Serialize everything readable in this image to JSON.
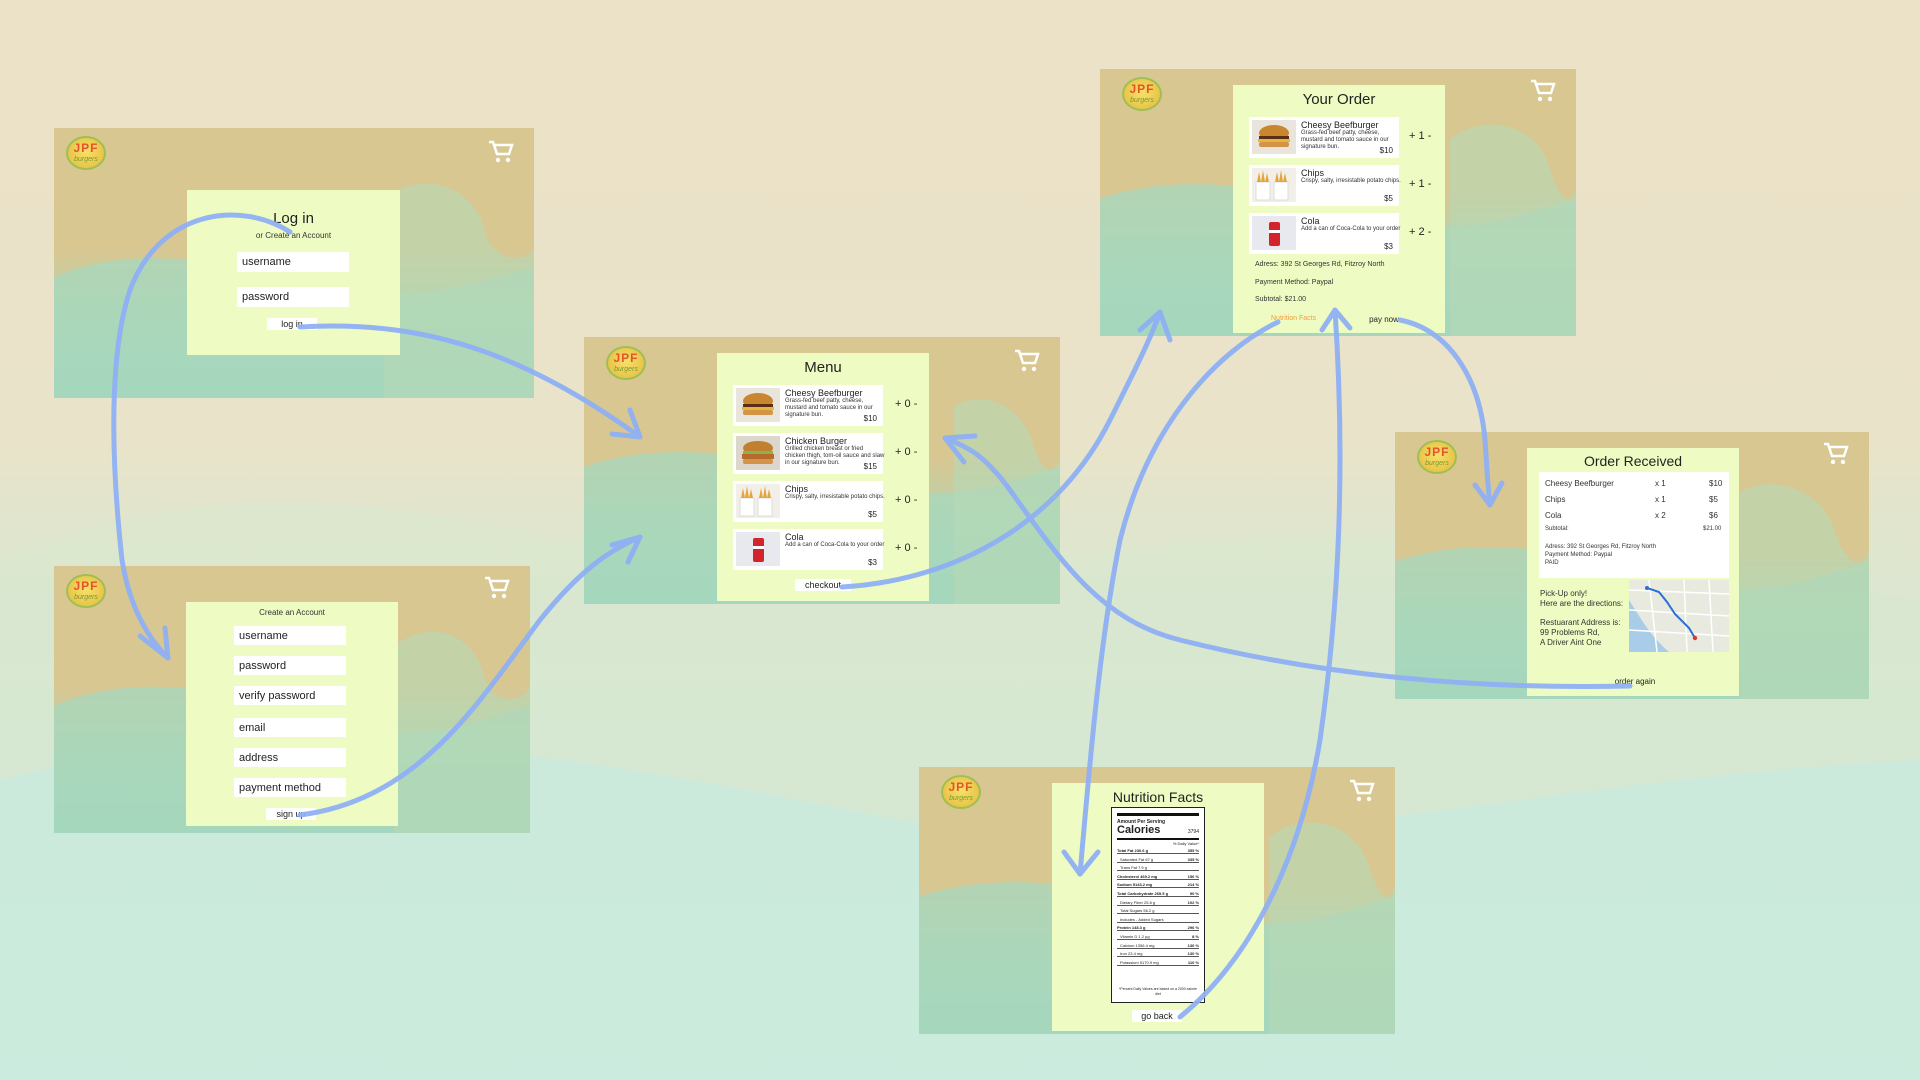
{
  "brand": {
    "logo_line1": "JPF",
    "logo_line2": "burgers"
  },
  "colors": {
    "card_bg": "#eefcc3",
    "accent_orange": "#f39c3c",
    "arrow": "#8fb0f4",
    "header_tan": "#d8c790",
    "footer_teal": "#92d6c5"
  },
  "icons": {
    "cart": "cart-icon",
    "logo": "logo-icon"
  },
  "login": {
    "title": "Log in",
    "subtitle": "or Create an Account",
    "username_placeholder": "username",
    "password_placeholder": "password",
    "login_button": "log in"
  },
  "signup": {
    "title": "Create an Account",
    "fields": [
      "username",
      "password",
      "verify password",
      "email",
      "address",
      "payment method"
    ],
    "signup_button": "sign up"
  },
  "menu": {
    "title": "Menu",
    "items": [
      {
        "name": "Cheesy Beefburger",
        "desc": "Grass-fed beef patty, cheese, mustard and tomato sauce in our signature bun.",
        "price": "$10",
        "plus": "+",
        "qty": "0",
        "minus": "-"
      },
      {
        "name": "Chicken Burger",
        "desc": "Grilled chicken breast or fried chicken thigh, tom-oil sauce and slaw in our signature bun.",
        "price": "$15",
        "plus": "+",
        "qty": "0",
        "minus": "-"
      },
      {
        "name": "Chips",
        "desc": "Crispy, salty, irresistable potato chips.",
        "price": "$5",
        "plus": "+",
        "qty": "0",
        "minus": "-"
      },
      {
        "name": "Cola",
        "desc": "Add a can of Coca-Cola to your order",
        "price": "$3",
        "plus": "+",
        "qty": "0",
        "minus": "-"
      }
    ],
    "checkout_button": "checkout"
  },
  "order": {
    "title": "Your Order",
    "items": [
      {
        "name": "Cheesy Beefburger",
        "desc": "Grass-fed beef patty, cheese, mustard and tomato sauce in our signature bun.",
        "price": "$10",
        "plus": "+",
        "qty": "1",
        "minus": "-"
      },
      {
        "name": "Chips",
        "desc": "Crispy, salty, irresistable potato chips.",
        "price": "$5",
        "plus": "+",
        "qty": "1",
        "minus": "-"
      },
      {
        "name": "Cola",
        "desc": "Add a can of Coca-Cola to your order",
        "price": "$3",
        "plus": "+",
        "qty": "2",
        "minus": "-"
      }
    ],
    "address": "Adress:  392 St Georges Rd, Fitzroy North",
    "payment": "Payment Method:  Paypal",
    "subtotal": "Subtotal:  $21.00",
    "nutrition_link": "Nutrition Facts",
    "pay_button": "pay now"
  },
  "received": {
    "title": "Order Received",
    "rows": [
      {
        "name": "Cheesy Beefburger",
        "qty": "x 1",
        "price": "$10"
      },
      {
        "name": "Chips",
        "qty": "x 1",
        "price": "$5"
      },
      {
        "name": "Cola",
        "qty": "x 2",
        "price": "$6"
      }
    ],
    "subtotal_label": "Subtotal:",
    "subtotal_value": "$21.00",
    "address": "Adress:  392 St Georges Rd, Fitzroy North",
    "payment": "Payment Method:  Paypal",
    "status": "PAID",
    "pickup_line1": "Pick-Up only!",
    "pickup_line2": "Here are the directions:",
    "rest_line1": "Restuarant Address is:",
    "rest_line2": "99 Problems Rd,",
    "rest_line3": "A Driver Aint One",
    "order_again_button": "order again"
  },
  "nutrition": {
    "title": "Nutrition Facts",
    "serving_label": "Amount Per Serving",
    "calories_label": "Calories",
    "calories_value": "3794",
    "dv_header": "% Daily Value*",
    "rows": [
      {
        "label": "Total Fat 230.6 g",
        "value": "355 %",
        "bold": true
      },
      {
        "label": "Saturated Fat 67 g",
        "value": "335 %",
        "bold": false
      },
      {
        "label": "Trans Fat 7.9 g",
        "value": "",
        "bold": false
      },
      {
        "label": "Cholesterol 469.2 mg",
        "value": "156 %",
        "bold": true
      },
      {
        "label": "Sodium 5143.2 mg",
        "value": "214 %",
        "bold": true
      },
      {
        "label": "Total Carbohydrate 269.5 g",
        "value": "90 %",
        "bold": true
      },
      {
        "label": "Dietary Fiber 25.6 g",
        "value": "102 %",
        "bold": false
      },
      {
        "label": "Total Sugars 56.2 g",
        "value": "",
        "bold": false
      },
      {
        "label": "Includes - Added Sugars",
        "value": "",
        "bold": false
      },
      {
        "label": "Protein 148.3 g",
        "value": "296 %",
        "bold": true
      },
      {
        "label": "Vitamin D 1.2 µg",
        "value": "8 %",
        "bold": false
      },
      {
        "label": "Calcium 1356.4 mg",
        "value": "136 %",
        "bold": false
      },
      {
        "label": "Iron 23.4 mg",
        "value": "130 %",
        "bold": false
      },
      {
        "label": "Potassium 5170.9 mg",
        "value": "110 %",
        "bold": false
      }
    ],
    "footnote": "*Percent Daily Values are based on a 2000 calorie diet",
    "go_back_button": "go back"
  }
}
